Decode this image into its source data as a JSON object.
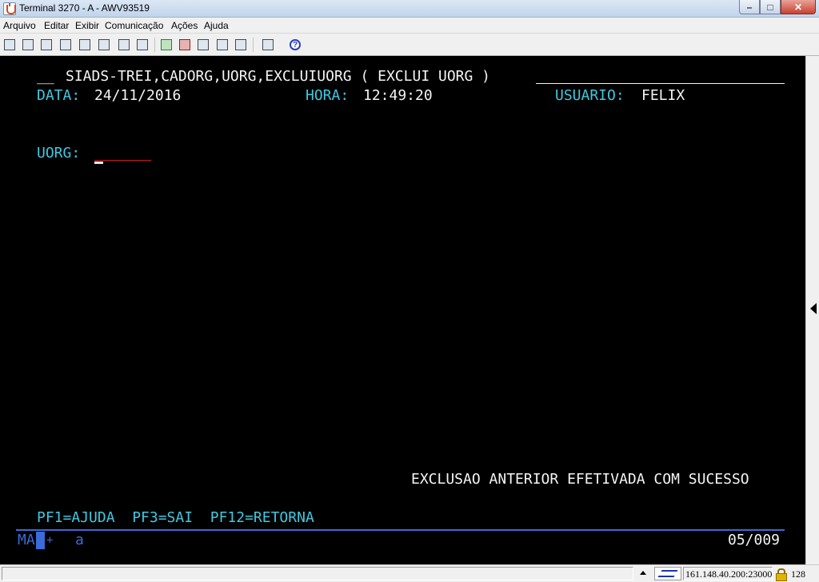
{
  "window": {
    "title": "Terminal 3270 - A - AWV93519",
    "min_glyph": "–",
    "max_glyph": "□",
    "close_glyph": "✕"
  },
  "menu": [
    "Arquivo",
    "Editar",
    "Exibir",
    "Comunicação",
    "Ações",
    "Ajuda"
  ],
  "toolbar": {
    "icons": [
      "copy-screen-icon",
      "print-icon",
      "transfer-icon",
      "copy-icon",
      "paste-icon",
      "clipboard-icon",
      "macro-icon",
      "keypad-icon",
      "play-macro-icon",
      "stop-macro-icon",
      "record-icon",
      "pause-icon",
      "send-icon",
      "settings-icon",
      "help-icon"
    ],
    "help_glyph": "?"
  },
  "screen": {
    "header_prefix": "__",
    "header_title": "SIADS-TREI,CADORG,UORG,EXCLUIUORG ( EXCLUI UORG )",
    "date_label": "DATA:",
    "date_value": "24/11/2016",
    "time_label": "HORA:",
    "time_value": "12:49:20",
    "user_label": "USUARIO:",
    "user_value": "FELIX",
    "uorg_label": "UORG:",
    "uorg_value": "",
    "message": "EXCLUSAO ANTERIOR EFETIVADA COM SUCESSO",
    "pf_keys": "PF1=AJUDA  PF3=SAI  PF12=RETORNA"
  },
  "oia": {
    "session": "MA",
    "session_cursor": "A",
    "plus": "+",
    "mode": "a",
    "cursor_position": "05/009"
  },
  "statusbar": {
    "host": "161.148.40.200:23000",
    "key_size": "128"
  },
  "colors": {
    "terminal_bg": "#000000",
    "field_cyan": "#40c8e0",
    "text_white": "#f4f4f4",
    "oia_blue": "#3a6bd8",
    "input_underline": "#d21e1e"
  }
}
